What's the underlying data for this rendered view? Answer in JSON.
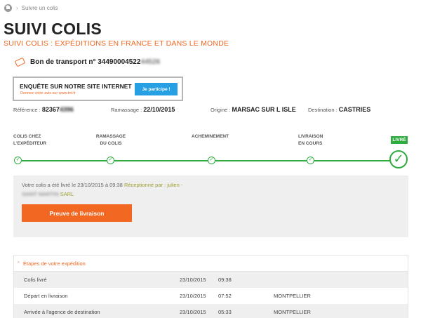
{
  "breadcrumb": {
    "current": "Suivre un colis"
  },
  "page": {
    "title": "SUIVI COLIS",
    "subtitle": "SUIVI COLIS : EXPÉDITIONS EN FRANCE ET DANS LE MONDE"
  },
  "tracking": {
    "label": "Bon de transport n°",
    "number_visible": "34490004522",
    "number_hidden": "44526"
  },
  "promo": {
    "title": "ENQUÊTE SUR NOTRE SITE INTERNET",
    "subtitle": "Donnez votre avis sur www.tnt.fr",
    "button": "Je participe !"
  },
  "info": {
    "reference_label": "Référence :",
    "reference_visible": "82367",
    "reference_hidden": "4396",
    "pickup_label": "Ramassage :",
    "pickup_value": "22/10/2015",
    "origin_label": "Origine :",
    "origin_value": "MARSAC SUR L ISLE",
    "destination_label": "Destination :",
    "destination_value": "CASTRIES"
  },
  "steps": [
    {
      "line1": "COLIS CHEZ",
      "line2": "L'EXPÉDITEUR"
    },
    {
      "line1": "RAMASSAGE",
      "line2": "DU COLIS"
    },
    {
      "line1": "ACHEMINEMENT",
      "line2": ""
    },
    {
      "line1": "LIVRAISON",
      "line2": "EN COURS"
    }
  ],
  "final_step": "LIVRÉ",
  "delivery": {
    "text_part1": "Votre colis a été livré le 23/10/2015 à 09:38",
    "received_by": "Réceptionné par : julien -",
    "company_hidden": "SAINT MARTIN",
    "company_suffix": "SARL",
    "proof_button": "Preuve de livraison"
  },
  "etapes": {
    "header": "Étapes de votre expédition",
    "rows": [
      {
        "status": "Colis livré",
        "date": "23/10/2015",
        "time": "09:38",
        "place": ""
      },
      {
        "status": "Départ en livraison",
        "date": "23/10/2015",
        "time": "07:52",
        "place": "MONTPELLIER"
      },
      {
        "status": "Arrivée à l'agence de destination",
        "date": "23/10/2015",
        "time": "05:33",
        "place": "MONTPELLIER"
      }
    ]
  },
  "colors": {
    "accent": "#f26722",
    "success": "#2fab3f",
    "info": "#27a0e3",
    "received": "#9ba02d"
  },
  "icons": [
    "home-icon",
    "ticket-icon",
    "check-icon",
    "chevron-up-icon"
  ]
}
